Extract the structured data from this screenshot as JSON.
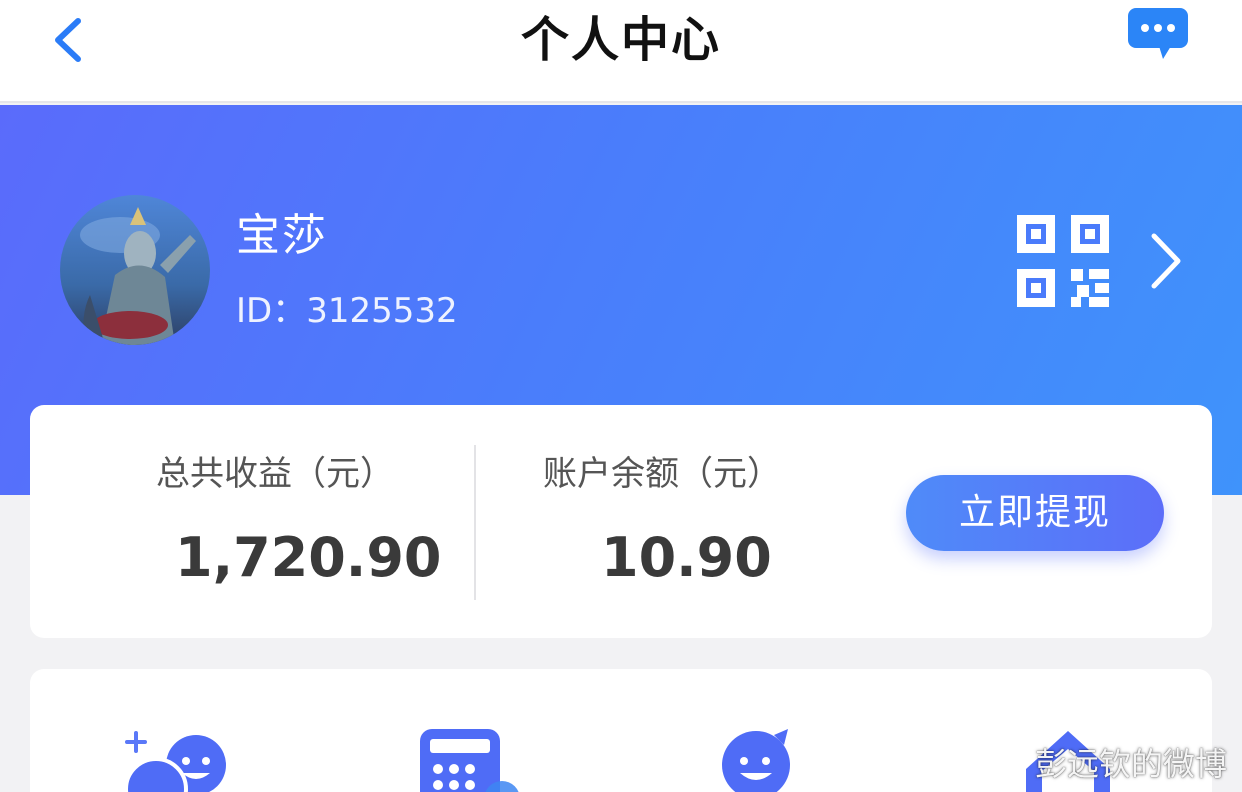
{
  "nav": {
    "title": "个人中心",
    "back_icon": "chevron-left-icon",
    "message_icon": "chat-bubble-icon"
  },
  "profile": {
    "name": "宝莎",
    "id_text": "ID：3125532",
    "qr_icon": "qr-code-icon",
    "arrow_icon": "chevron-right-icon"
  },
  "earnings": {
    "total_label": "总共收益（元）",
    "total_value": "1,720.90",
    "balance_label": "账户余额（元）",
    "balance_value": "10.90",
    "withdraw_label": "立即提现"
  },
  "menu": {
    "items": [
      {
        "icon": "add-friends-icon"
      },
      {
        "icon": "calculator-icon"
      },
      {
        "icon": "smiley-person-icon"
      },
      {
        "icon": "home-shield-icon"
      }
    ]
  },
  "watermark": {
    "text": "彭远钦的微博"
  },
  "colors": {
    "banner_start": "#5a6bfb",
    "banner_end": "#3f93fb",
    "accent": "#4f7bf9",
    "icon_blue": "#4f6cf6"
  }
}
